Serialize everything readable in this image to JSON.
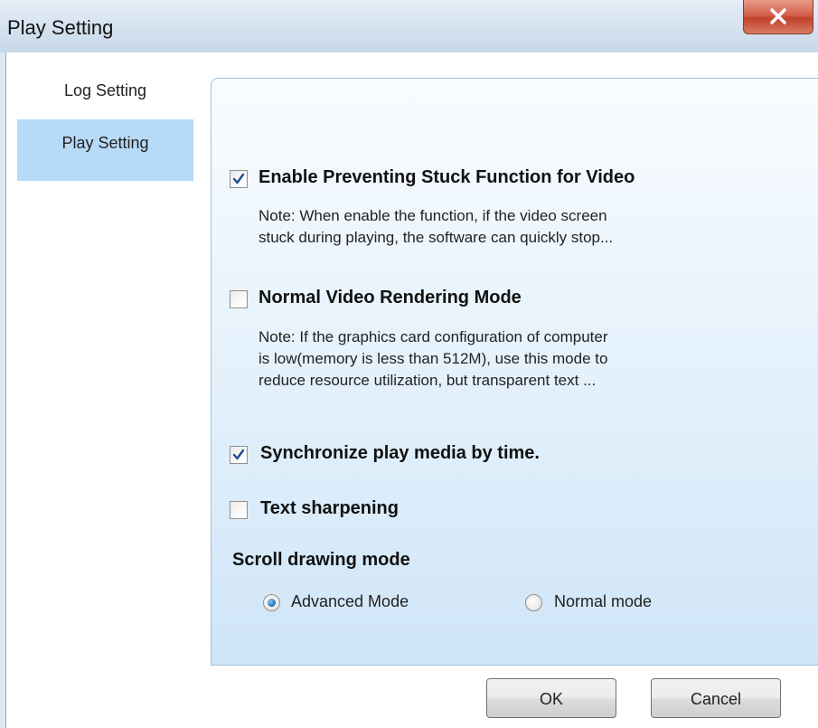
{
  "window": {
    "title": "Play Setting"
  },
  "sidebar": {
    "items": [
      {
        "label": "Log Setting",
        "active": false
      },
      {
        "label": "Play Setting",
        "active": true
      }
    ]
  },
  "settings": {
    "prevent_stuck": {
      "label": "Enable Preventing Stuck Function for Video",
      "checked": true,
      "note_line1": "Note: When enable the function, if the video screen",
      "note_line2": "stuck during playing, the software can quickly stop..."
    },
    "normal_rendering": {
      "label": "Normal Video Rendering Mode",
      "checked": false,
      "note_line1": "Note: If the graphics card configuration of computer",
      "note_line2": "is low(memory is less than 512M), use this mode to",
      "note_line3": "reduce resource utilization, but transparent text ..."
    },
    "sync_media": {
      "label": "Synchronize play media by time.",
      "checked": true
    },
    "text_sharpening": {
      "label": "Text sharpening",
      "checked": false
    },
    "scroll_mode": {
      "heading": "Scroll drawing mode",
      "options": [
        {
          "label": "Advanced Mode",
          "selected": true
        },
        {
          "label": "Normal mode",
          "selected": false
        }
      ]
    }
  },
  "buttons": {
    "ok": "OK",
    "cancel": "Cancel"
  },
  "colors": {
    "nav_active": "#b7daf7",
    "panel_border": "#9dc2e3",
    "close_red": "#c0422c",
    "radio_dot": "#2f78c2"
  },
  "icons": {
    "check": "checkmark-icon",
    "close": "close-icon"
  }
}
